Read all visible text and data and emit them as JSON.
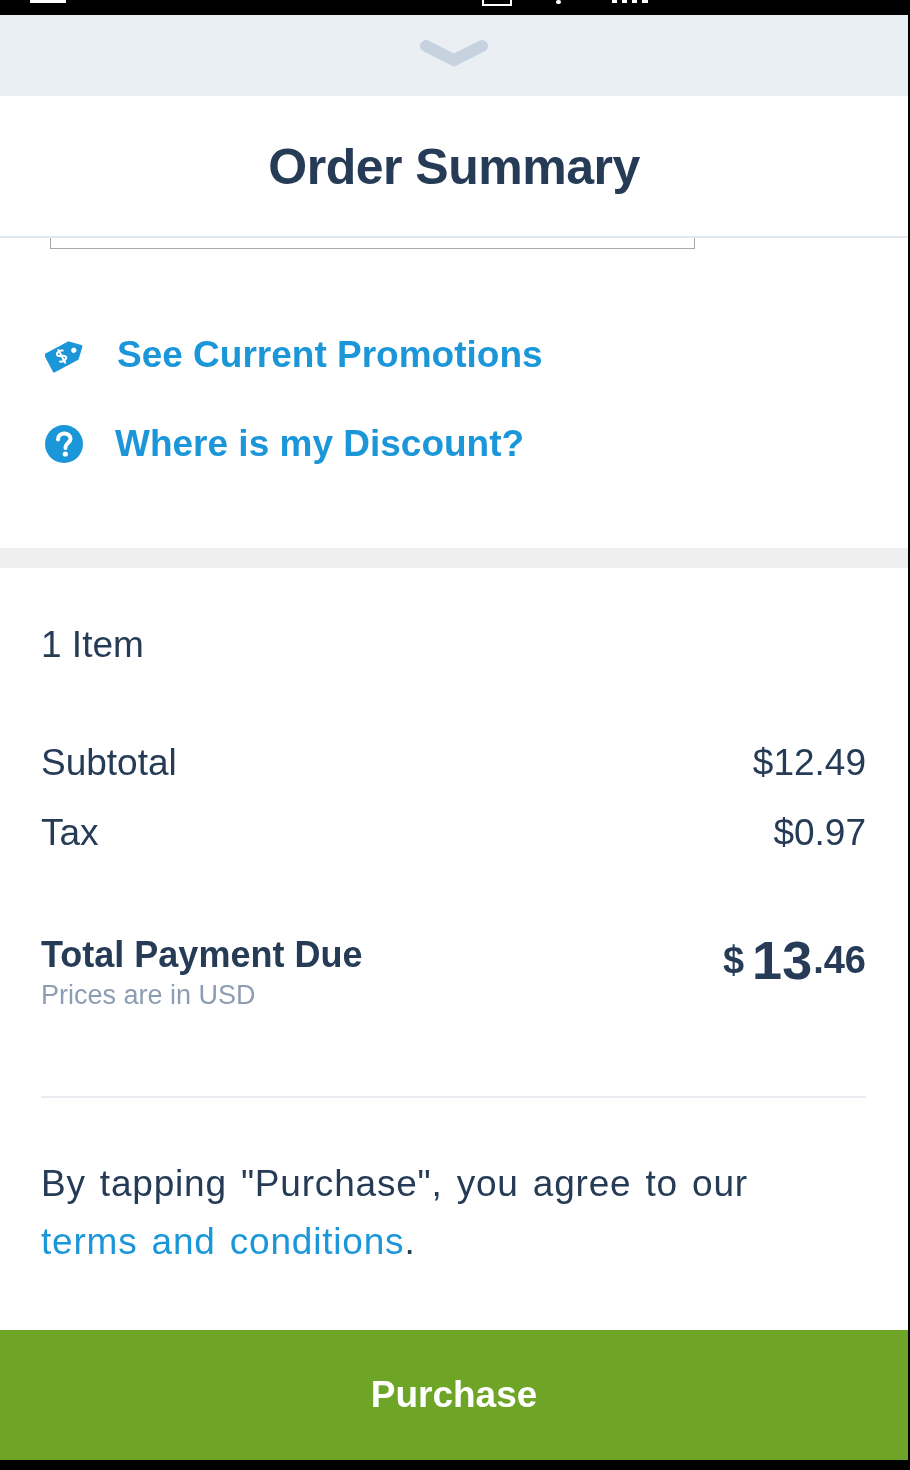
{
  "sheet": {
    "title": "Order Summary"
  },
  "links": [
    {
      "kind": "promotions",
      "label": "See Current Promotions"
    },
    {
      "kind": "help",
      "label": "Where is my Discount?"
    }
  ],
  "summary": {
    "item_count": "1 Item",
    "rows": [
      {
        "label": "Subtotal",
        "value": "$12.49"
      },
      {
        "label": "Tax",
        "value": "$0.97"
      }
    ],
    "total": {
      "label": "Total Payment Due",
      "note": "Prices are in USD",
      "amount": {
        "symbol": "$",
        "whole": "13",
        "fraction": ".46"
      }
    }
  },
  "agreement": {
    "text": "By tapping \"Purchase\", you agree to our",
    "link": "terms and conditions",
    "end": "."
  },
  "purchase_button": {
    "label": "Purchase"
  }
}
